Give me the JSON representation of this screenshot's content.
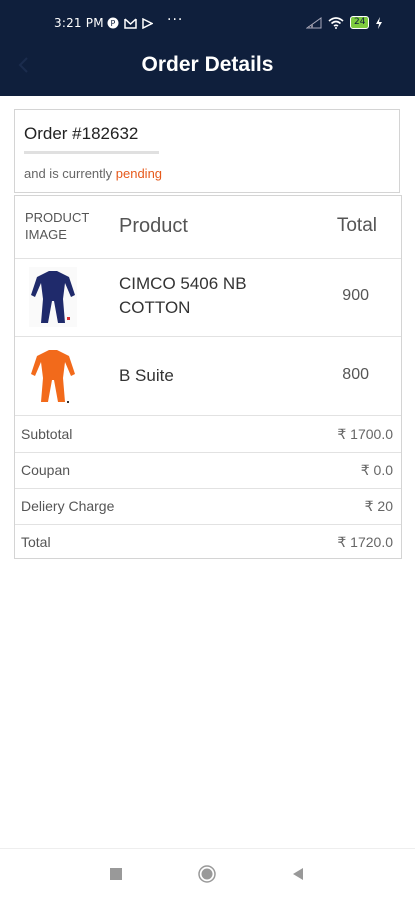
{
  "status_bar": {
    "time": "3:21 PM",
    "overflow": "···",
    "battery": "24",
    "icons": [
      "p-app-icon",
      "mail-icon",
      "play-icon",
      "signal-icon",
      "wifi-icon",
      "battery-icon",
      "charging-icon"
    ]
  },
  "header": {
    "title": "Order Details"
  },
  "order": {
    "number": "Order #182632",
    "status_prefix": "and is currently ",
    "status": "pending",
    "status_color": "#e65a1c"
  },
  "table": {
    "columns": {
      "image": "PRODUCT IMAGE",
      "image_line1": "PRODUCT",
      "image_line2": "IMAGE",
      "product": "Product",
      "total": "Total"
    },
    "items": [
      {
        "name": "CIMCO 5406 NB COTTON",
        "total": "900",
        "color": "#1f2a6b"
      },
      {
        "name": "B Suite",
        "total": "800",
        "color": "#f26a1b"
      }
    ],
    "summary": [
      {
        "label": "Subtotal",
        "value": "₹ 1700.0"
      },
      {
        "label": "Coupan",
        "value": "₹ 0.0"
      },
      {
        "label": "Deliery Charge",
        "value": "₹ 20"
      },
      {
        "label": "Total",
        "value": "₹ 1720.0"
      }
    ]
  },
  "colors": {
    "header_bg": "#0f1f3c",
    "accent": "#e65a1c"
  }
}
